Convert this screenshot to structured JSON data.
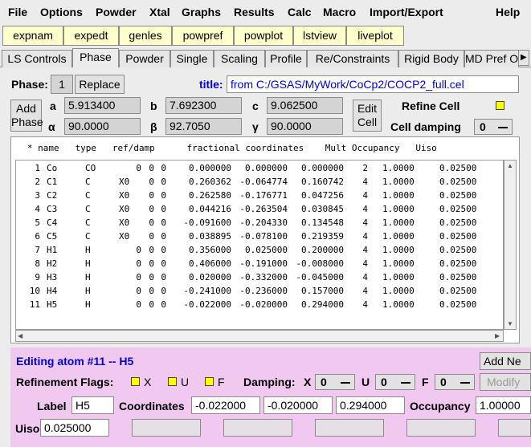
{
  "menu": [
    "File",
    "Options",
    "Powder",
    "Xtal",
    "Graphs",
    "Results",
    "Calc",
    "Macro",
    "Import/Export",
    "Help"
  ],
  "toolbar": [
    "expnam",
    "expedt",
    "genles",
    "powpref",
    "powplot",
    "lstview",
    "liveplot"
  ],
  "tabs": [
    "LS Controls",
    "Phase",
    "Powder",
    "Single",
    "Scaling",
    "Profile",
    "Re/Constraints",
    "Rigid Body",
    "MD Pref O"
  ],
  "active_tab": "Phase",
  "phase": {
    "label": "Phase:",
    "number": "1",
    "replace_label": "Replace",
    "title_label": "title:",
    "title_value": "from C:/GSAS/MyWork/CoCp2/COCP2_full.cel",
    "add_phase_line1": "Add",
    "add_phase_line2": "Phase",
    "edit_cell_line1": "Edit",
    "edit_cell_line2": "Cell",
    "cell": {
      "a_label": "a",
      "a": "5.913400",
      "b_label": "b",
      "b": "7.692300",
      "c_label": "c",
      "c": "9.062500",
      "alpha_label": "α",
      "alpha": "90.0000",
      "beta_label": "β",
      "beta": "92.7050",
      "gamma_label": "γ",
      "gamma": "90.0000"
    },
    "refine_cell_label": "Refine Cell",
    "cell_damping_label": "Cell damping",
    "cell_damping_value": "0"
  },
  "atoms": {
    "header": "   * name   type   ref/damp      fractional coordinates    Mult Occupancy   Uiso",
    "rows": [
      {
        "n": "1",
        "name": "Co",
        "type": "CO",
        "ref": "",
        "d1": "0",
        "d2": "0",
        "d3": "0",
        "x": "0.000000",
        "y": "0.000000",
        "z": "0.000000",
        "mult": "2",
        "occ": "1.0000",
        "uiso": "0.02500"
      },
      {
        "n": "2",
        "name": "C1",
        "type": "C",
        "ref": "X0",
        "d1": "",
        "d2": "0",
        "d3": "0",
        "x": "0.260362",
        "y": "-0.064774",
        "z": "0.160742",
        "mult": "4",
        "occ": "1.0000",
        "uiso": "0.02500"
      },
      {
        "n": "3",
        "name": "C2",
        "type": "C",
        "ref": "X0",
        "d1": "",
        "d2": "0",
        "d3": "0",
        "x": "0.262580",
        "y": "-0.176771",
        "z": "0.047256",
        "mult": "4",
        "occ": "1.0000",
        "uiso": "0.02500"
      },
      {
        "n": "4",
        "name": "C3",
        "type": "C",
        "ref": "X0",
        "d1": "",
        "d2": "0",
        "d3": "0",
        "x": "0.044216",
        "y": "-0.263504",
        "z": "0.030845",
        "mult": "4",
        "occ": "1.0000",
        "uiso": "0.02500"
      },
      {
        "n": "5",
        "name": "C4",
        "type": "C",
        "ref": "X0",
        "d1": "",
        "d2": "0",
        "d3": "0",
        "x": "-0.091600",
        "y": "-0.204330",
        "z": "0.134548",
        "mult": "4",
        "occ": "1.0000",
        "uiso": "0.02500"
      },
      {
        "n": "6",
        "name": "C5",
        "type": "C",
        "ref": "X0",
        "d1": "",
        "d2": "0",
        "d3": "0",
        "x": "0.038895",
        "y": "-0.078100",
        "z": "0.219359",
        "mult": "4",
        "occ": "1.0000",
        "uiso": "0.02500"
      },
      {
        "n": "7",
        "name": "H1",
        "type": "H",
        "ref": "",
        "d1": "0",
        "d2": "0",
        "d3": "0",
        "x": "0.356000",
        "y": "0.025000",
        "z": "0.200000",
        "mult": "4",
        "occ": "1.0000",
        "uiso": "0.02500"
      },
      {
        "n": "8",
        "name": "H2",
        "type": "H",
        "ref": "",
        "d1": "0",
        "d2": "0",
        "d3": "0",
        "x": "0.406000",
        "y": "-0.191000",
        "z": "-0.008000",
        "mult": "4",
        "occ": "1.0000",
        "uiso": "0.02500"
      },
      {
        "n": "9",
        "name": "H3",
        "type": "H",
        "ref": "",
        "d1": "0",
        "d2": "0",
        "d3": "0",
        "x": "0.020000",
        "y": "-0.332000",
        "z": "-0.045000",
        "mult": "4",
        "occ": "1.0000",
        "uiso": "0.02500"
      },
      {
        "n": "10",
        "name": "H4",
        "type": "H",
        "ref": "",
        "d1": "0",
        "d2": "0",
        "d3": "0",
        "x": "-0.241000",
        "y": "-0.236000",
        "z": "0.157000",
        "mult": "4",
        "occ": "1.0000",
        "uiso": "0.02500"
      },
      {
        "n": "11",
        "name": "H5",
        "type": "H",
        "ref": "",
        "d1": "0",
        "d2": "0",
        "d3": "0",
        "x": "-0.022000",
        "y": "-0.020000",
        "z": "0.294000",
        "mult": "4",
        "occ": "1.0000",
        "uiso": "0.02500"
      }
    ]
  },
  "edit": {
    "heading": "Editing atom #11 -- H5",
    "add_new_label": "Add Ne",
    "modify_label": "Modify",
    "flags_label": "Refinement Flags:",
    "flag_x": "X",
    "flag_u": "U",
    "flag_f": "F",
    "damping_label": "Damping:",
    "damp_x_label": "X",
    "damp_x": "0",
    "damp_u_label": "U",
    "damp_u": "0",
    "damp_f_label": "F",
    "damp_f": "0",
    "label_label": "Label",
    "label_value": "H5",
    "coords_label": "Coordinates",
    "coord_x": "-0.022000",
    "coord_y": "-0.020000",
    "coord_z": "0.294000",
    "occupancy_label": "Occupancy",
    "occupancy_value": "1.00000",
    "uiso_label": "Uiso",
    "uiso_value": "0.025000"
  },
  "colors": {
    "accent_blue": "#0000cc",
    "flag_yellow": "#ffff00",
    "edit_panel": "#f0c8f0",
    "toolbar_button": "#ffffcc"
  }
}
